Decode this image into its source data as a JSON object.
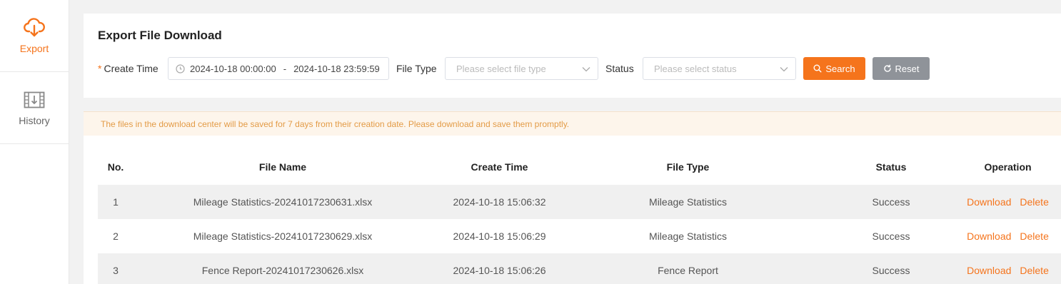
{
  "sidebar": {
    "items": [
      {
        "label": "Export",
        "icon": "cloud-download-icon",
        "active": true
      },
      {
        "label": "History",
        "icon": "film-download-icon",
        "active": false
      }
    ]
  },
  "colors": {
    "accent": "#f5741c",
    "reset": "#8f9399",
    "notice_bg": "#fdf5eb",
    "notice_text": "#e39b46",
    "row_shade": "#f0f0f0"
  },
  "filters": {
    "title": "Export File Download",
    "required_mark": "*",
    "create_time_label": "Create Time",
    "start_time": "2024-10-18 00:00:00",
    "range_separator": "-",
    "end_time": "2024-10-18 23:59:59",
    "file_type_label": "File Type",
    "file_type_placeholder": "Please select file type",
    "status_label": "Status",
    "status_placeholder": "Please select status",
    "search_label": "Search",
    "reset_label": "Reset"
  },
  "notice": "The files in the download center will be saved for 7 days from their creation date. Please download and save them promptly.",
  "table": {
    "columns": [
      "No.",
      "File Name",
      "Create Time",
      "File Type",
      "Status",
      "Operation"
    ],
    "rows": [
      {
        "no": "1",
        "file_name": "Mileage Statistics-20241017230631.xlsx",
        "create_time": "2024-10-18 15:06:32",
        "file_type": "Mileage Statistics",
        "status": "Success",
        "download": "Download",
        "delete": "Delete"
      },
      {
        "no": "2",
        "file_name": "Mileage Statistics-20241017230629.xlsx",
        "create_time": "2024-10-18 15:06:29",
        "file_type": "Mileage Statistics",
        "status": "Success",
        "download": "Download",
        "delete": "Delete"
      },
      {
        "no": "3",
        "file_name": "Fence Report-20241017230626.xlsx",
        "create_time": "2024-10-18 15:06:26",
        "file_type": "Fence Report",
        "status": "Success",
        "download": "Download",
        "delete": "Delete"
      }
    ]
  }
}
